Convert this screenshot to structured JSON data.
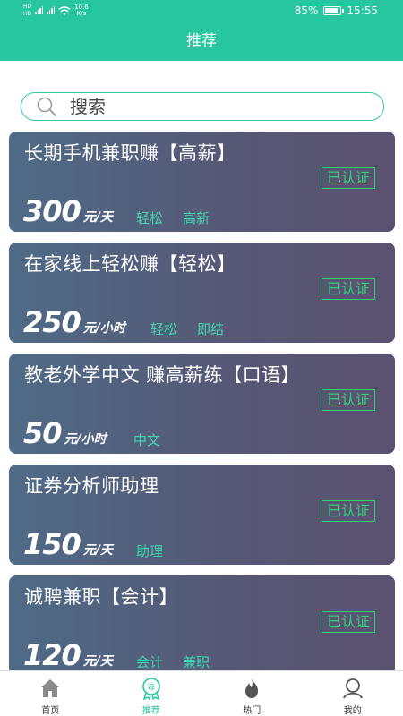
{
  "status_bar": {
    "network_left_top": "HD",
    "network_left_bottom": "HD",
    "net_speed_value": "10.6",
    "net_speed_unit": "K/s",
    "battery_percent": "85%",
    "time": "15:55"
  },
  "header": {
    "title": "推荐"
  },
  "search": {
    "placeholder": "搜索",
    "value": ""
  },
  "jobs": [
    {
      "title": "长期手机兼职赚【高薪】",
      "badge": "已认证",
      "price": "300",
      "unit": "元/天",
      "tags": [
        "轻松",
        "高新"
      ]
    },
    {
      "title": "在家线上轻松赚【轻松】",
      "badge": "已认证",
      "price": "250",
      "unit": "元/小时",
      "tags": [
        "轻松",
        "即结"
      ]
    },
    {
      "title": "教老外学中文 赚高薪练【口语】",
      "badge": "已认证",
      "price": "50",
      "unit": "元/小时",
      "tags": [
        "中文"
      ]
    },
    {
      "title": "证券分析师助理",
      "badge": "已认证",
      "price": "150",
      "unit": "元/天",
      "tags": [
        "助理"
      ]
    },
    {
      "title": "诚聘兼职【会计】",
      "badge": "已认证",
      "price": "120",
      "unit": "元/天",
      "tags": [
        "会计",
        "兼职"
      ]
    }
  ],
  "tabbar": {
    "items": [
      {
        "label": "首页",
        "icon": "home-icon",
        "active": false
      },
      {
        "label": "推荐",
        "icon": "recommend-badge-icon",
        "active": true
      },
      {
        "label": "热门",
        "icon": "flame-icon",
        "active": false
      },
      {
        "label": "我的",
        "icon": "user-icon",
        "active": false
      }
    ]
  },
  "colors": {
    "accent": "#27c6a0",
    "badge": "#2fd176",
    "tag": "#42d6b1",
    "card_start": "#4f6b87",
    "card_end": "#5b5271"
  }
}
